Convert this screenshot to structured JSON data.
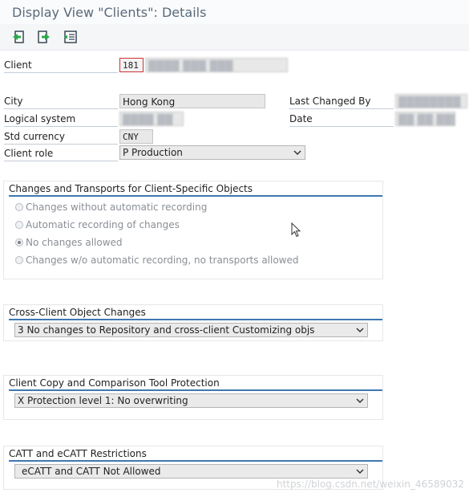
{
  "window": {
    "title": "Display View \"Clients\": Details"
  },
  "toolbar": {
    "buttons": [
      {
        "icon": "previous-entry-icon"
      },
      {
        "icon": "next-entry-icon"
      },
      {
        "icon": "variable-list-icon"
      }
    ]
  },
  "form": {
    "client_label": "Client",
    "client_value": "181",
    "client_desc": "████ ███ ███",
    "city_label": "City",
    "city_value": "Hong Kong",
    "logical_system_label": "Logical system",
    "logical_system_value": "████ ██",
    "std_currency_label": "Std currency",
    "std_currency_value": "CNY",
    "client_role_label": "Client role",
    "client_role_value": "P Production",
    "last_changed_by_label": "Last Changed By",
    "last_changed_by_value": "████████",
    "date_label": "Date",
    "date_value": "██.██.████"
  },
  "changes_group": {
    "title": "Changes and Transports for Client-Specific Objects",
    "options": [
      {
        "label": "Changes without automatic recording",
        "checked": false
      },
      {
        "label": "Automatic recording of changes",
        "checked": false
      },
      {
        "label": "No changes allowed",
        "checked": true
      },
      {
        "label": "Changes w/o automatic recording, no transports allowed",
        "checked": false
      }
    ]
  },
  "cross_client_group": {
    "title": "Cross-Client Object Changes",
    "value": "3 No changes to Repository and cross-client Customizing objs"
  },
  "copy_group": {
    "title": "Client Copy and Comparison Tool Protection",
    "value": "X Protection level 1: No overwriting"
  },
  "catt_group": {
    "title": "CATT and eCATT Restrictions",
    "value": "eCATT and CATT Not Allowed"
  },
  "watermark": "https://blog.csdn.net/weixin_46589032",
  "colors": {
    "accent_rule": "#3f78b3",
    "field_bg": "#e8e8e8"
  }
}
